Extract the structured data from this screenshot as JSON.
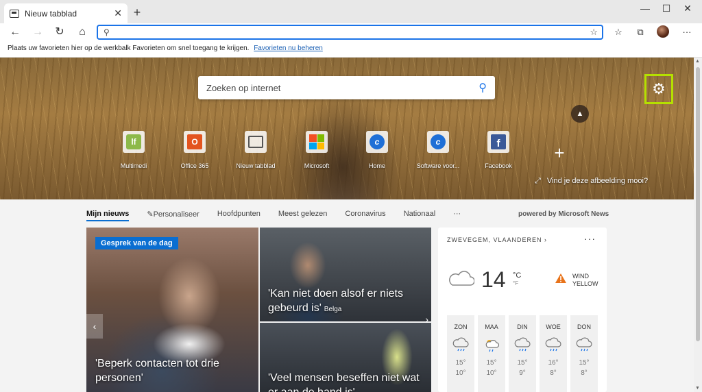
{
  "tab": {
    "title": "Nieuw tabblad",
    "close": "✕",
    "new": "+"
  },
  "window": {
    "minimize": "—",
    "maximize": "☐",
    "close": "✕"
  },
  "toolbar": {
    "back": "←",
    "forward": "→",
    "refresh": "↻",
    "home": "⌂",
    "address_value": "",
    "favorites_icon": "☆",
    "collections_icon": "⧉",
    "menu": "···"
  },
  "favbar": {
    "text": "Plaats uw favorieten hier op de werkbalk Favorieten om snel toegang te krijgen.",
    "link": "Favorieten nu beheren"
  },
  "hero": {
    "search_placeholder": "Zoeken op internet",
    "tiles": [
      {
        "label": "Multimedi",
        "icon": "multimedia-icon"
      },
      {
        "label": "Office 365",
        "icon": "office-icon"
      },
      {
        "label": "Nieuw tabblad",
        "icon": "newtab-icon"
      },
      {
        "label": "Microsoft",
        "icon": "microsoft-icon"
      },
      {
        "label": "Home",
        "icon": "home-c-icon"
      },
      {
        "label": "Software voor...",
        "icon": "software-c-icon"
      },
      {
        "label": "Facebook",
        "icon": "facebook-icon"
      }
    ],
    "like_image": "Vind je deze afbeelding mooi?"
  },
  "news": {
    "tabs": [
      "Mijn nieuws",
      "Personaliseer",
      "Hoofdpunten",
      "Meest gelezen",
      "Coronavirus",
      "Nationaal"
    ],
    "more": "···",
    "powered": "powered by Microsoft News",
    "card1": {
      "badge": "Gesprek van de dag",
      "headline": "'Beperk contacten tot drie personen'"
    },
    "card2": {
      "headline": "'Kan niet doen alsof er niets gebeurd is'",
      "source": "Belga"
    },
    "card3": {
      "headline": "'Veel mensen beseffen niet wat er aan de hand is'"
    }
  },
  "weather": {
    "location": "ZWEVEGEM, VLAANDEREN",
    "temp": "14",
    "unit_c": "°C",
    "unit_f": "°F",
    "alert_line1": "WIND",
    "alert_line2": "YELLOW",
    "days": [
      {
        "name": "ZON",
        "hi": "15°",
        "lo": "10°"
      },
      {
        "name": "MAA",
        "hi": "15°",
        "lo": "10°"
      },
      {
        "name": "DIN",
        "hi": "15°",
        "lo": "9°"
      },
      {
        "name": "WOE",
        "hi": "16°",
        "lo": "8°"
      },
      {
        "name": "DON",
        "hi": "15°",
        "lo": "8°"
      }
    ]
  }
}
